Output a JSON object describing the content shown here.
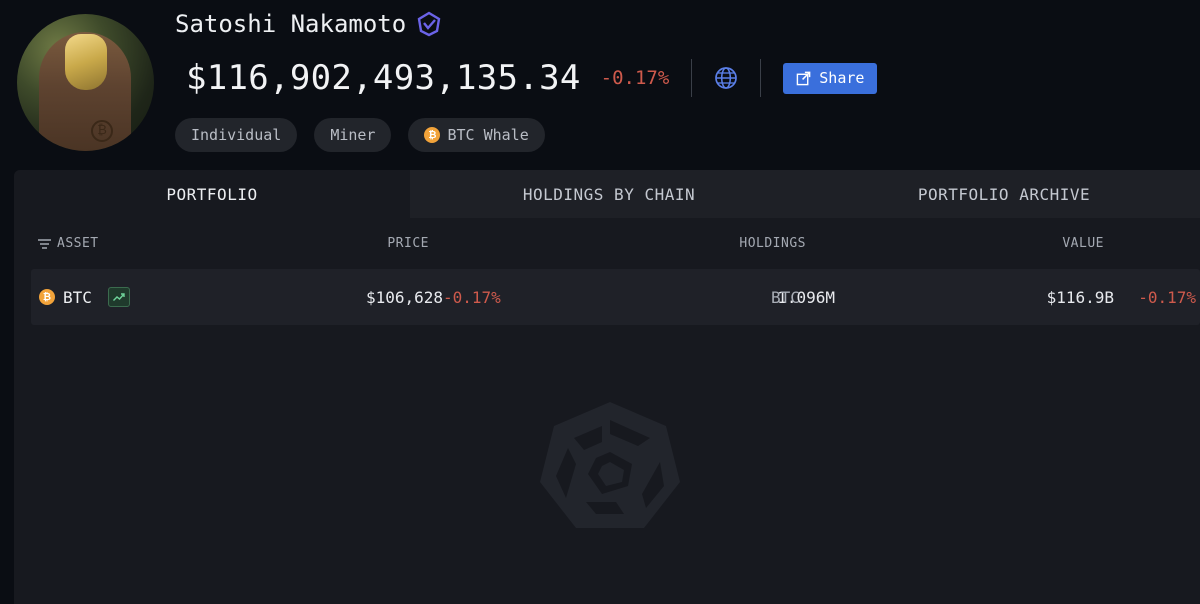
{
  "profile": {
    "name": "Satoshi Nakamoto",
    "verified_icon": "arkham-verified-icon",
    "balance": "$116,902,493,135.34",
    "balance_change": "-0.17%",
    "share_label": "Share",
    "tags": [
      {
        "label": "Individual"
      },
      {
        "label": "Miner"
      },
      {
        "label": "BTC Whale",
        "icon": "btc-icon"
      }
    ]
  },
  "tabs": [
    {
      "label": "PORTFOLIO",
      "active": true
    },
    {
      "label": "HOLDINGS BY CHAIN",
      "active": false
    },
    {
      "label": "PORTFOLIO ARCHIVE",
      "active": false
    }
  ],
  "table": {
    "headers": {
      "asset": "ASSET",
      "price": "PRICE",
      "holdings": "HOLDINGS",
      "value": "VALUE"
    },
    "rows": [
      {
        "asset": "BTC",
        "price": "$106,628",
        "price_change": "-0.17%",
        "holdings": "1.096M",
        "holdings_unit": "BTC",
        "value": "$116.9B",
        "value_change": "-0.17%"
      }
    ]
  },
  "colors": {
    "background": "#0a0d13",
    "panel": "#17191f",
    "negative": "#cf5a4c",
    "accent": "#3a6fdc",
    "btc": "#f2a33a"
  }
}
